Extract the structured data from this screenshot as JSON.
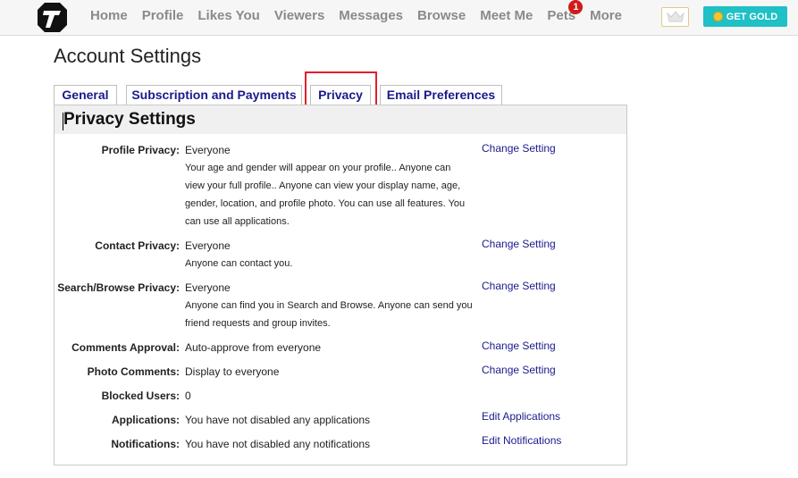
{
  "nav": {
    "items": [
      "Home",
      "Profile",
      "Likes You",
      "Viewers",
      "Messages",
      "Browse",
      "Meet Me",
      "Pets",
      "More"
    ],
    "pets_badge": "1",
    "gold_button": "GET GOLD"
  },
  "page": {
    "title": "Account Settings"
  },
  "tabs": [
    {
      "label": "General"
    },
    {
      "label": "Subscription and Payments"
    },
    {
      "label": "Privacy"
    },
    {
      "label": "Email Preferences"
    }
  ],
  "panel": {
    "title": "Privacy Settings",
    "rows": [
      {
        "label": "Profile Privacy:",
        "value": "Everyone",
        "description": "Your age and gender will appear on your profile.. Anyone can view your full profile.. Anyone can view your display name, age, gender, location, and profile photo. You can use all features. You can use all applications.",
        "action": "Change Setting"
      },
      {
        "label": "Contact Privacy:",
        "value": "Everyone",
        "description": "Anyone can contact you.",
        "action": "Change Setting"
      },
      {
        "label": "Search/Browse Privacy:",
        "value": "Everyone",
        "description": "Anyone can find you in Search and Browse. Anyone can send you friend requests and group invites.",
        "action": "Change Setting"
      },
      {
        "label": "Comments Approval:",
        "value": "Auto-approve from everyone",
        "action": "Change Setting"
      },
      {
        "label": "Photo Comments:",
        "value": "Display to everyone",
        "action": "Change Setting"
      },
      {
        "label": "Blocked Users:",
        "value": "0"
      },
      {
        "label": "Applications:",
        "value": "You have not disabled any applications",
        "action": "Edit Applications"
      },
      {
        "label": "Notifications:",
        "value": "You have not disabled any notifications",
        "action": "Edit Notifications"
      }
    ]
  }
}
